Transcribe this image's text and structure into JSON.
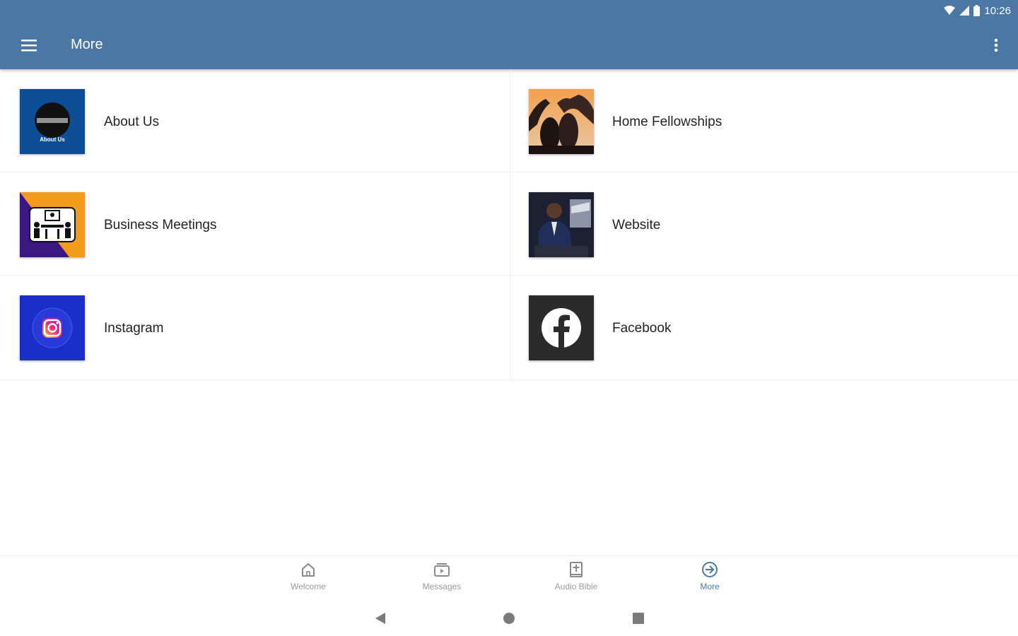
{
  "status_bar": {
    "time": "10:26"
  },
  "app_bar": {
    "title": "More",
    "menu_icon": "hamburger-menu-icon",
    "overflow_icon": "more-vert-icon",
    "color": "#4a77a3"
  },
  "tiles": [
    {
      "label": "About Us",
      "thumb": "about-us-logo",
      "thumb_text": "About Us"
    },
    {
      "label": "Home Fellowships",
      "thumb": "home-fellowships-photo"
    },
    {
      "label": "Business Meetings",
      "thumb": "business-meetings-illustration"
    },
    {
      "label": "Website",
      "thumb": "website-photo"
    },
    {
      "label": "Instagram",
      "thumb": "instagram-logo"
    },
    {
      "label": "Facebook",
      "thumb": "facebook-logo"
    }
  ],
  "bottom_nav": [
    {
      "label": "Welcome",
      "icon": "home-icon",
      "active": false
    },
    {
      "label": "Messages",
      "icon": "messages-icon",
      "active": false
    },
    {
      "label": "Audio Bible",
      "icon": "audio-bible-icon",
      "active": false
    },
    {
      "label": "More",
      "icon": "more-arrow-icon",
      "active": true
    }
  ],
  "system_nav": [
    "back-icon",
    "home-circle-icon",
    "recents-icon"
  ],
  "colors": {
    "primary": "#4a77a3",
    "about_us_bg": "#0d4f96",
    "instagram_bg": "#1a2fc9",
    "facebook_bg": "#2b2b2b"
  }
}
